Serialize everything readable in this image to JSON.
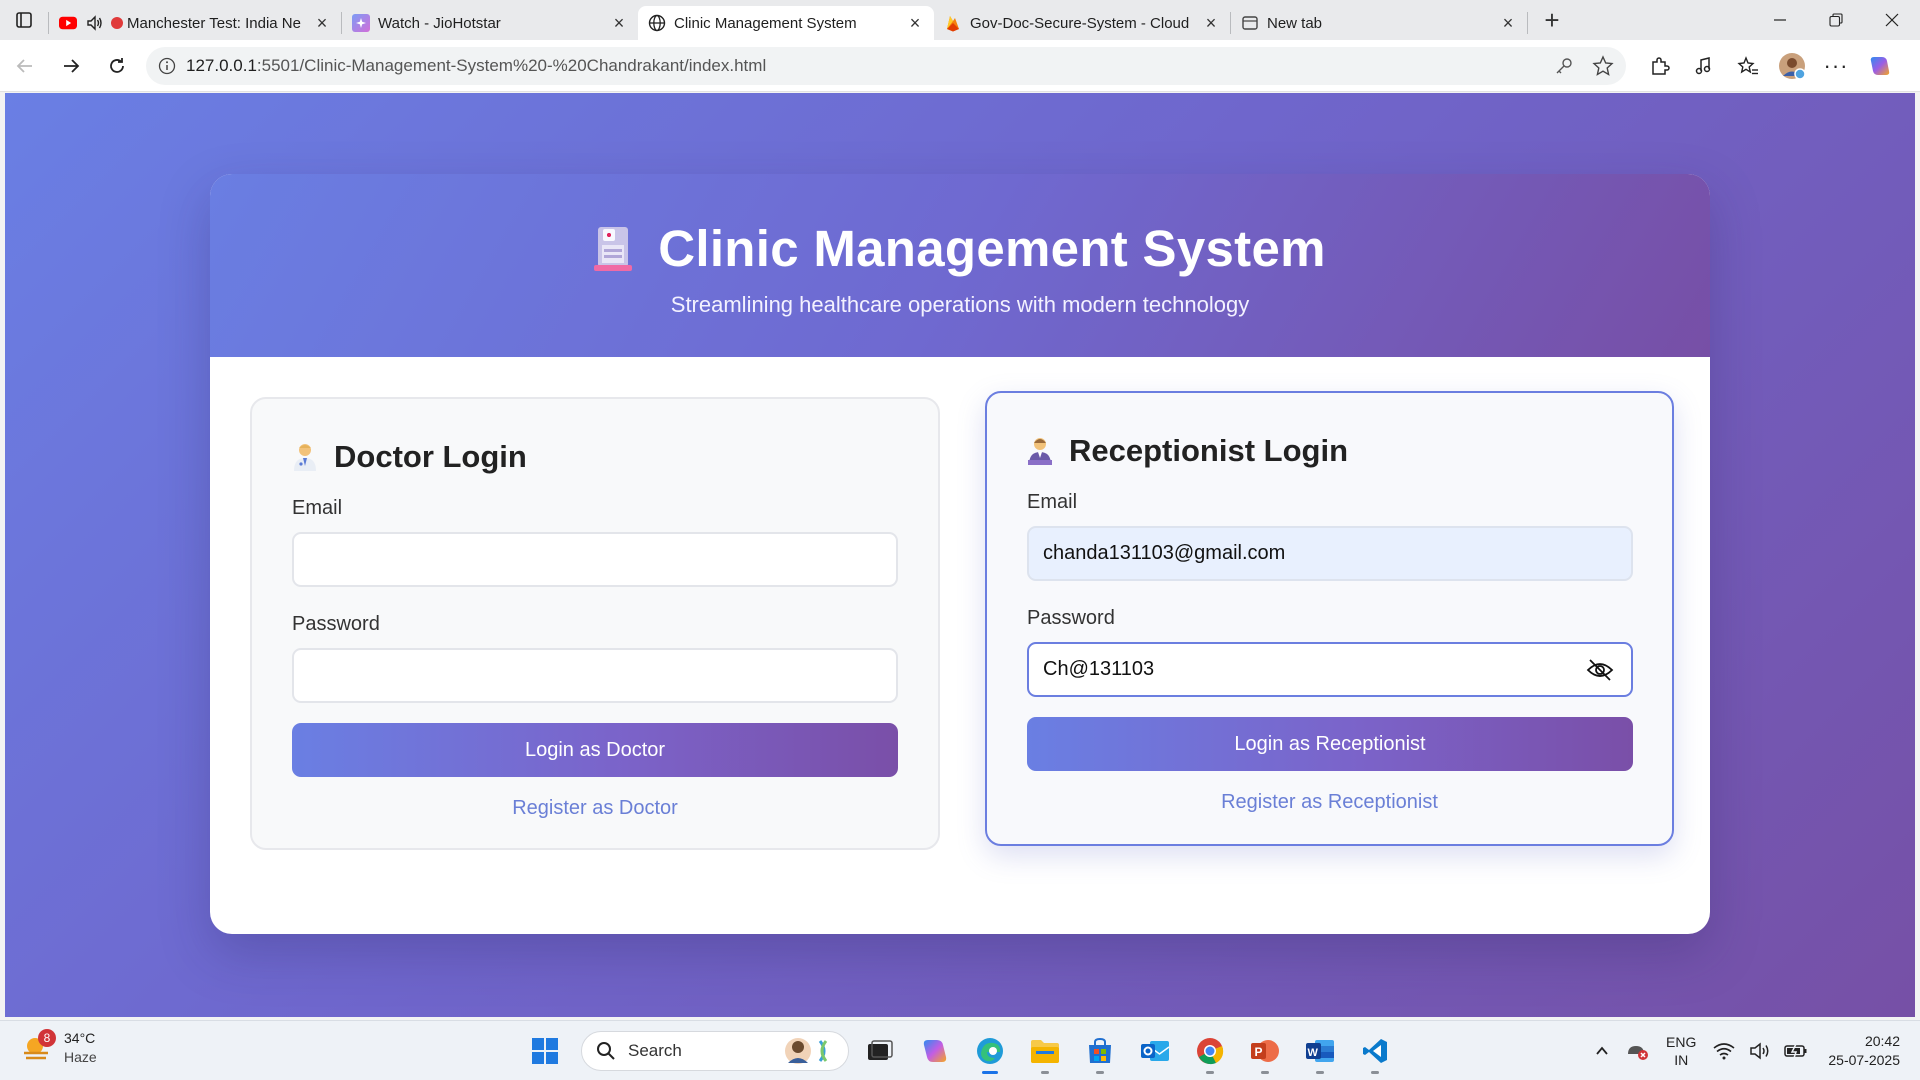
{
  "browser": {
    "tabs": [
      {
        "title": "Manchester Test: India Ne",
        "favicon": "youtube-icon",
        "audio": true,
        "active": false
      },
      {
        "title": "Watch - JioHotstar",
        "favicon": "jiohotstar-icon",
        "active": false
      },
      {
        "title": "Clinic Management System",
        "favicon": "globe-icon",
        "active": true
      },
      {
        "title": "Gov-Doc-Secure-System - Cloud",
        "favicon": "firebase-icon",
        "active": false
      },
      {
        "title": "New tab",
        "favicon": "newtab-icon",
        "active": false
      }
    ],
    "url_host": "127.0.0.1",
    "url_path": ":5501/Clinic-Management-System%20-%20Chandrakant/index.html"
  },
  "header": {
    "title": "Clinic Management System",
    "subtitle": "Streamlining healthcare operations with modern technology"
  },
  "doctor": {
    "title": "Doctor Login",
    "email_label": "Email",
    "email_value": "",
    "password_label": "Password",
    "password_value": "",
    "login_button": "Login as Doctor",
    "register_link": "Register as Doctor"
  },
  "receptionist": {
    "title": "Receptionist Login",
    "email_label": "Email",
    "email_value": "chanda131103@gmail.com",
    "password_label": "Password",
    "password_value": "Ch@131103",
    "login_button": "Login as Receptionist",
    "register_link": "Register as Receptionist"
  },
  "taskbar": {
    "weather_temp": "34°C",
    "weather_desc": "Haze",
    "weather_badge": "8",
    "search_placeholder": "Search",
    "lang_line1": "ENG",
    "lang_line2": "IN",
    "time": "20:42",
    "date": "25-07-2025"
  },
  "colors": {
    "gradient_start": "#6a7fe4",
    "gradient_end": "#7650a6",
    "link": "#6a7fd6",
    "autofill_bg": "#e8f0fe"
  }
}
